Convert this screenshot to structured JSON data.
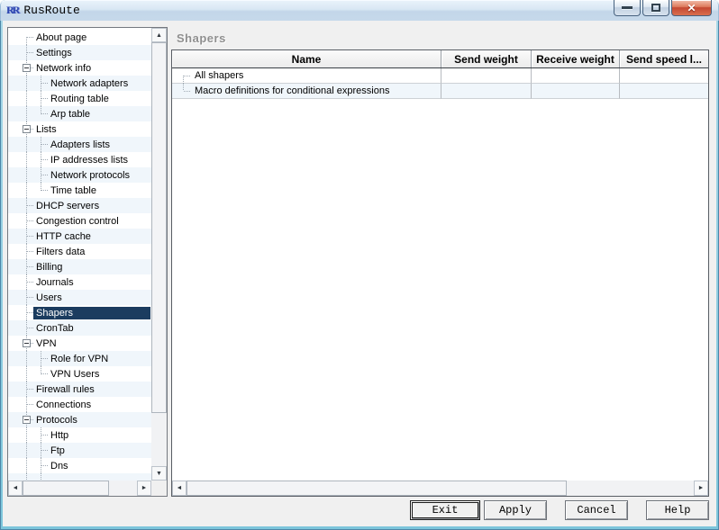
{
  "window": {
    "icon_text": "RR",
    "title": "RusRoute",
    "close_glyph": "✕"
  },
  "icons": {
    "up": "▲",
    "down": "▼",
    "left": "◄",
    "right": "►"
  },
  "sidebar": {
    "items": [
      {
        "label": "About page",
        "level": 0
      },
      {
        "label": "Settings",
        "level": 0
      },
      {
        "label": "Network info",
        "level": 0,
        "parent": true,
        "expanded": true
      },
      {
        "label": "Network adapters",
        "level": 1
      },
      {
        "label": "Routing table",
        "level": 1
      },
      {
        "label": "Arp table",
        "level": 1,
        "last_child": true
      },
      {
        "label": "Lists",
        "level": 0,
        "parent": true,
        "expanded": true
      },
      {
        "label": "Adapters lists",
        "level": 1
      },
      {
        "label": "IP addresses lists",
        "level": 1
      },
      {
        "label": "Network protocols",
        "level": 1
      },
      {
        "label": "Time table",
        "level": 1,
        "last_child": true
      },
      {
        "label": "DHCP servers",
        "level": 0
      },
      {
        "label": "Congestion control",
        "level": 0
      },
      {
        "label": "HTTP cache",
        "level": 0
      },
      {
        "label": "Filters data",
        "level": 0
      },
      {
        "label": "Billing",
        "level": 0
      },
      {
        "label": "Journals",
        "level": 0
      },
      {
        "label": "Users",
        "level": 0
      },
      {
        "label": "Shapers",
        "level": 0,
        "selected": true
      },
      {
        "label": "CronTab",
        "level": 0
      },
      {
        "label": "VPN",
        "level": 0,
        "parent": true,
        "expanded": true
      },
      {
        "label": "Role for VPN",
        "level": 1
      },
      {
        "label": "VPN Users",
        "level": 1,
        "last_child": true
      },
      {
        "label": "Firewall rules",
        "level": 0
      },
      {
        "label": "Connections",
        "level": 0
      },
      {
        "label": "Protocols",
        "level": 0,
        "parent": true,
        "expanded": true
      },
      {
        "label": "Http",
        "level": 1
      },
      {
        "label": "Ftp",
        "level": 1
      },
      {
        "label": "Dns",
        "level": 1
      },
      {
        "label": "",
        "level": 1
      }
    ]
  },
  "main": {
    "heading": "Shapers",
    "table": {
      "columns": [
        "Name",
        "Send weight",
        "Receive weight",
        "Send speed l..."
      ],
      "rows": [
        {
          "name": "All shapers",
          "send_weight": "",
          "receive_weight": "",
          "send_speed_limit": ""
        },
        {
          "name": "Macro definitions for conditional expressions",
          "send_weight": "",
          "receive_weight": "",
          "send_speed_limit": ""
        }
      ]
    }
  },
  "footer": {
    "buttons": [
      {
        "label": "Exit",
        "default": true
      },
      {
        "label": "Apply"
      },
      {
        "label": "Cancel"
      },
      {
        "label": "Help"
      }
    ]
  },
  "colors": {
    "selection": "#1b3c5f",
    "stripe": "#f0f6fb",
    "frame": "#7cc5db",
    "frame_light": "#a9d8e8",
    "titlebar_top": "#eaf3fb",
    "titlebar_bottom": "#c6d9ea",
    "close_red": "#c44832"
  }
}
